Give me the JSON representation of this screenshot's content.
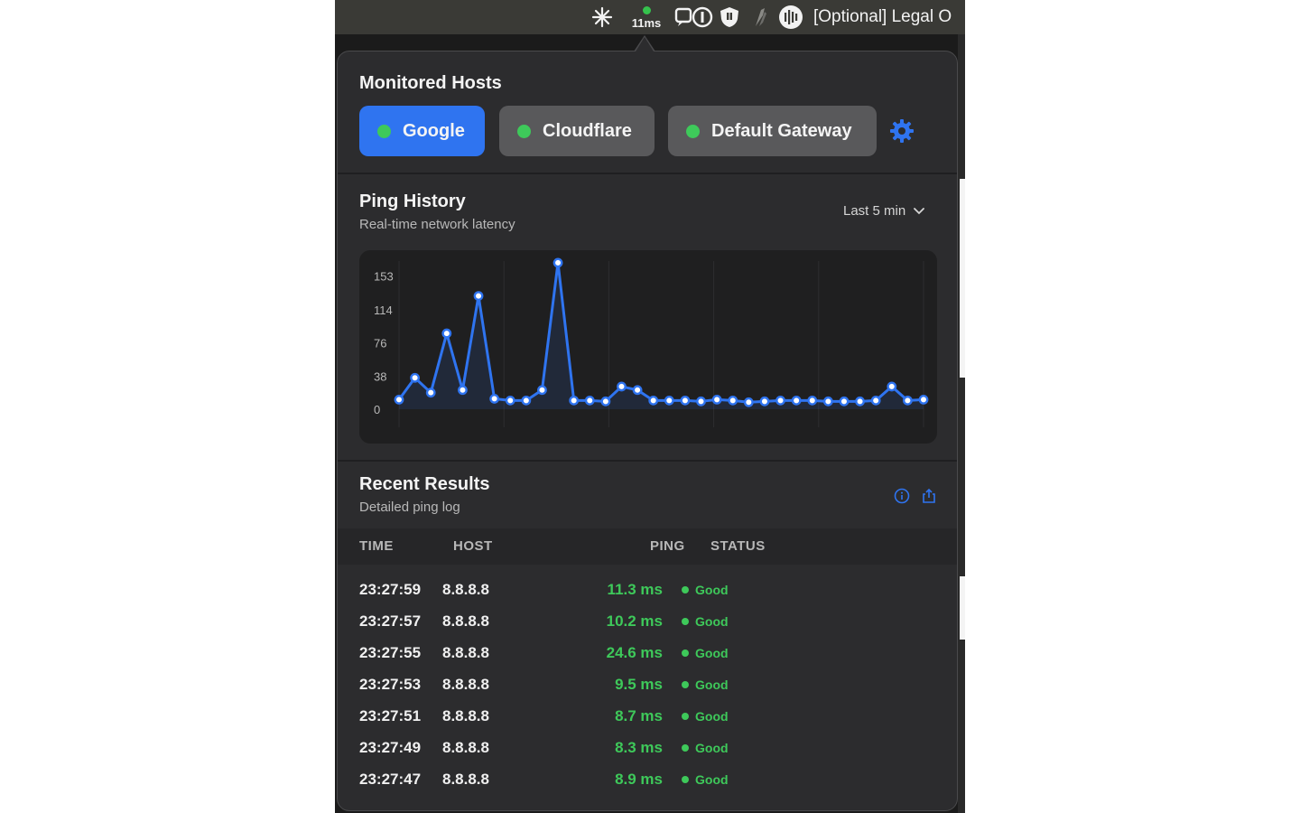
{
  "menubar": {
    "ping_label": "11ms",
    "title": "[Optional] Legal O",
    "icons": [
      "sparkle-icon",
      "ping-status-icon",
      "chat-info-icon",
      "shield-icon",
      "leaf-icon",
      "waveform-icon"
    ]
  },
  "hosts": {
    "title": "Monitored Hosts",
    "items": [
      {
        "label": "Google",
        "active": true
      },
      {
        "label": "Cloudflare",
        "active": false
      },
      {
        "label": "Default Gateway",
        "active": false
      }
    ],
    "settings_icon": "gear-icon"
  },
  "history": {
    "title": "Ping History",
    "subtitle": "Real-time network latency",
    "range_label": "Last 5 min"
  },
  "chart_data": {
    "type": "area",
    "y_ticks": [
      "153",
      "114",
      "76",
      "38",
      "0"
    ],
    "ylim": [
      0,
      170
    ],
    "grid": true,
    "series": [
      {
        "color": "#2f74f0",
        "values": [
          11,
          36,
          19,
          87,
          22,
          130,
          12,
          10,
          10,
          22,
          168,
          10,
          10,
          9,
          26,
          22,
          10,
          10,
          10,
          9,
          11,
          10,
          8,
          9,
          10,
          10,
          10,
          9,
          9,
          9,
          10,
          26,
          10,
          11
        ]
      }
    ]
  },
  "results": {
    "title": "Recent Results",
    "subtitle": "Detailed ping log",
    "columns": {
      "time": "TIME",
      "host": "HOST",
      "ping": "PING",
      "status": "STATUS"
    },
    "rows": [
      {
        "time": "23:27:59",
        "host": "8.8.8.8",
        "ping": "11.3 ms",
        "status": "Good"
      },
      {
        "time": "23:27:57",
        "host": "8.8.8.8",
        "ping": "10.2 ms",
        "status": "Good"
      },
      {
        "time": "23:27:55",
        "host": "8.8.8.8",
        "ping": "24.6 ms",
        "status": "Good"
      },
      {
        "time": "23:27:53",
        "host": "8.8.8.8",
        "ping": "9.5 ms",
        "status": "Good"
      },
      {
        "time": "23:27:51",
        "host": "8.8.8.8",
        "ping": "8.7 ms",
        "status": "Good"
      },
      {
        "time": "23:27:49",
        "host": "8.8.8.8",
        "ping": "8.3 ms",
        "status": "Good"
      },
      {
        "time": "23:27:47",
        "host": "8.8.8.8",
        "ping": "8.9 ms",
        "status": "Good"
      }
    ]
  },
  "colors": {
    "accent": "#2f74f0",
    "good": "#3ec95a",
    "panel": "#2c2c2e"
  }
}
